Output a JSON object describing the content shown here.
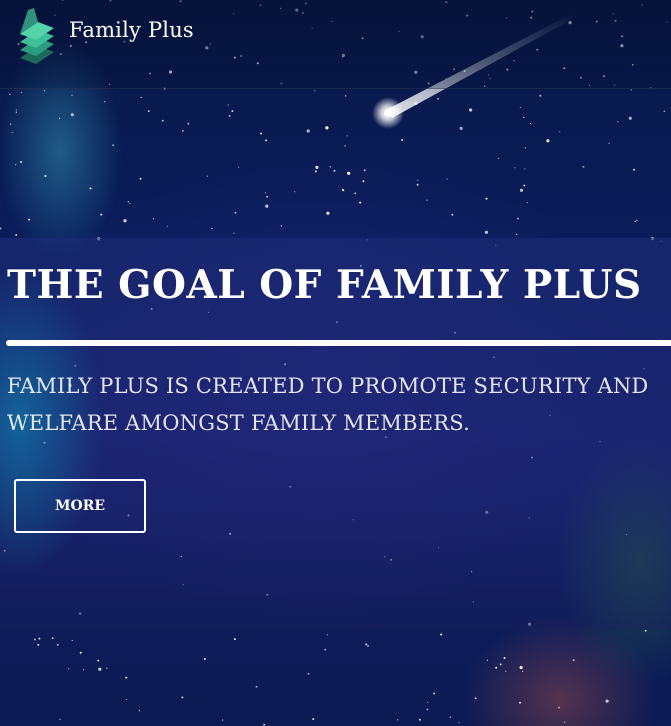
{
  "header": {
    "brand_name": "Family Plus",
    "logo_icon": "layered-book-logo"
  },
  "hero": {
    "title": "THE GOAL OF FAMILY PLUS",
    "subtitle": "FAMILY PLUS IS CREATED TO PROMOTE SECURITY AND WELFARE AMONGST FAMILY MEMBERS.",
    "more_label": "MORE"
  },
  "background": {
    "theme": "night-sky-with-shooting-star",
    "colors": {
      "sky_dark": "#061845",
      "sky_mid": "#13206a",
      "cyan_glow": "#00bed2",
      "text": "#ffffff"
    }
  }
}
